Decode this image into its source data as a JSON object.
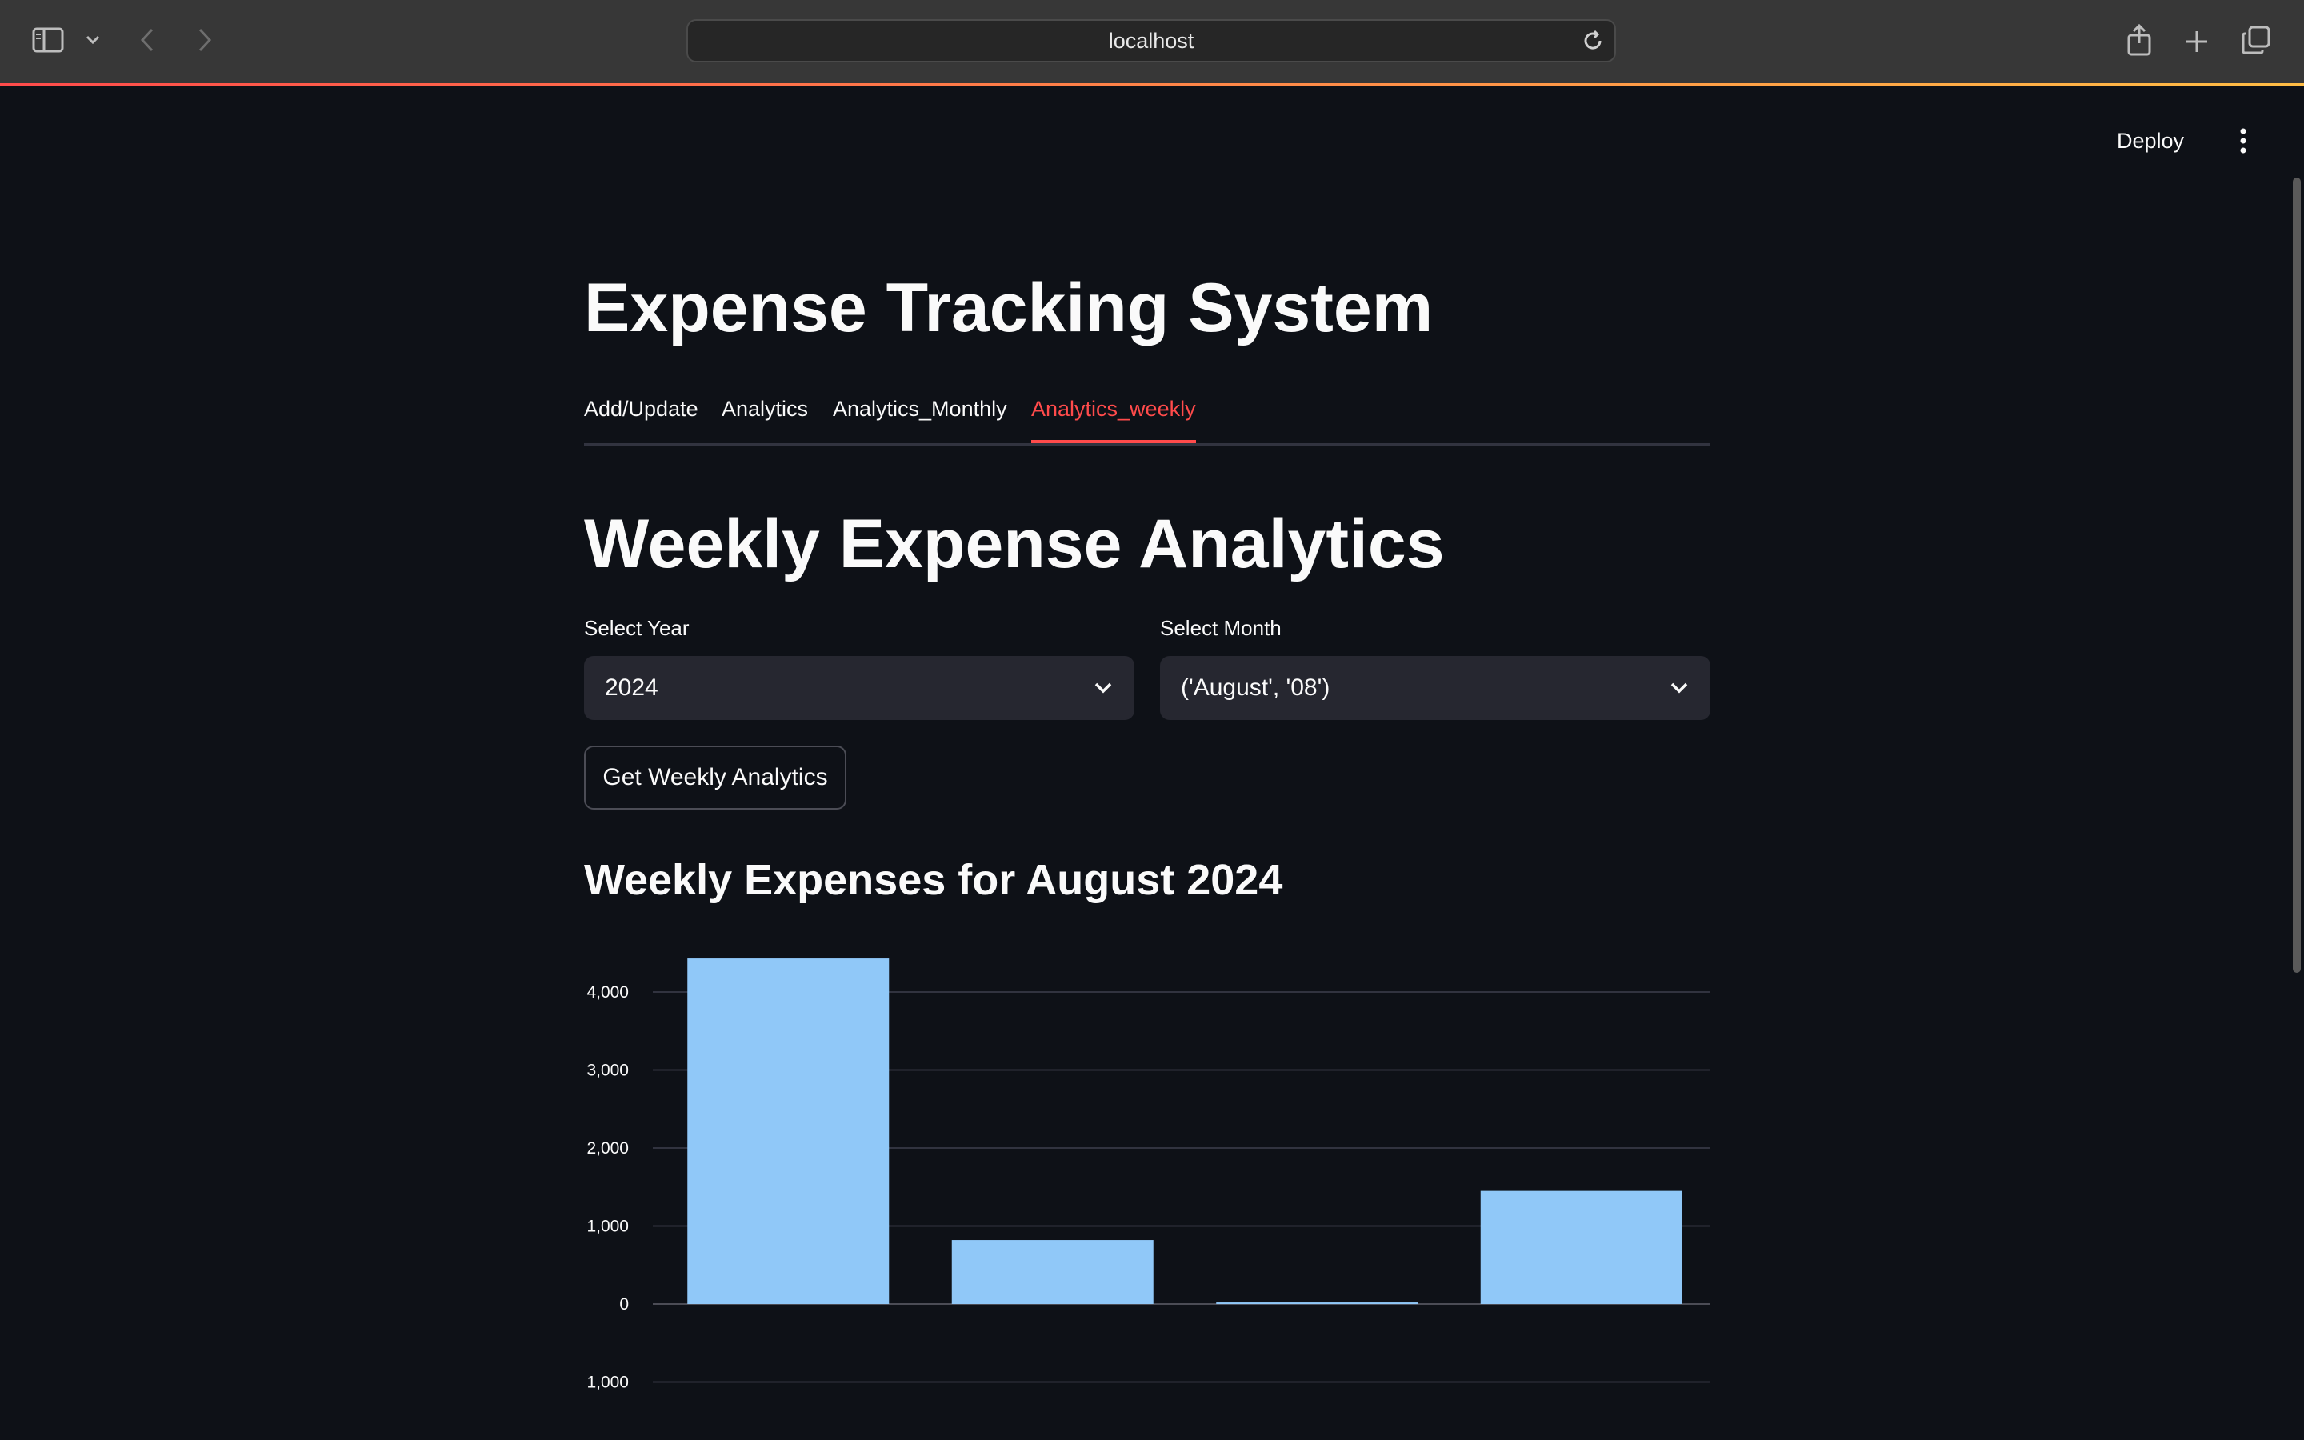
{
  "browser": {
    "url": "localhost",
    "icons": [
      "sidebar-icon",
      "chevron-down-icon",
      "back-icon",
      "forward-icon",
      "reload-icon",
      "share-icon",
      "plus-icon",
      "tabs-icon"
    ]
  },
  "header": {
    "deploy_label": "Deploy",
    "menu_icon": "kebab-icon"
  },
  "app": {
    "title": "Expense Tracking System",
    "tabs": [
      {
        "label": "Add/Update",
        "active": false
      },
      {
        "label": "Analytics",
        "active": false
      },
      {
        "label": "Analytics_Monthly",
        "active": false
      },
      {
        "label": "Analytics_weekly",
        "active": true
      }
    ],
    "accent_color": "#ff4b4b"
  },
  "weekly": {
    "heading": "Weekly Expense Analytics",
    "year_label": "Select Year",
    "year_value": "2024",
    "month_label": "Select Month",
    "month_value": "('August', '08')",
    "button_label": "Get Weekly Analytics",
    "chart_heading": "Weekly Expenses for August 2024"
  },
  "chart_data": {
    "type": "bar",
    "title": "",
    "xlabel": "",
    "ylabel": "",
    "categories": [
      "",
      "",
      "",
      ""
    ],
    "values": [
      4430,
      820,
      20,
      1450
    ],
    "ylim": [
      -1000,
      4430
    ],
    "yticks": [
      {
        "value": 4000,
        "label": "4,000"
      },
      {
        "value": 3000,
        "label": "3,000"
      },
      {
        "value": 2000,
        "label": "2,000"
      },
      {
        "value": 1000,
        "label": "1,000"
      },
      {
        "value": 0,
        "label": "0"
      },
      {
        "value": -1000,
        "label": "1,000"
      }
    ],
    "grid": true,
    "bar_color": "#90c8f8",
    "grid_color": "#31333f"
  }
}
